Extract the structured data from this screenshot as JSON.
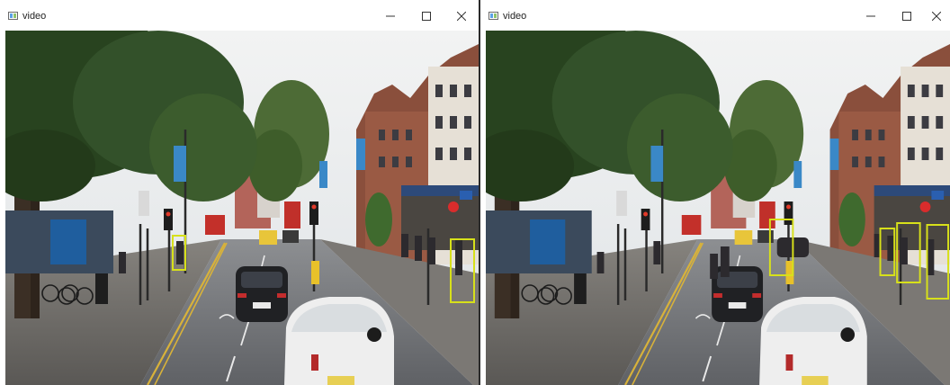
{
  "windows": [
    {
      "title": "video",
      "detections": 2
    },
    {
      "title": "video",
      "detections": 7
    }
  ],
  "controls": {
    "minimize_icon": "minimize-icon",
    "maximize_icon": "maximize-icon",
    "close_icon": "close-icon"
  },
  "colors": {
    "detection_box": "#d7e01a",
    "titlebar_bg": "#ffffff",
    "divider": "#2b2b2b"
  }
}
